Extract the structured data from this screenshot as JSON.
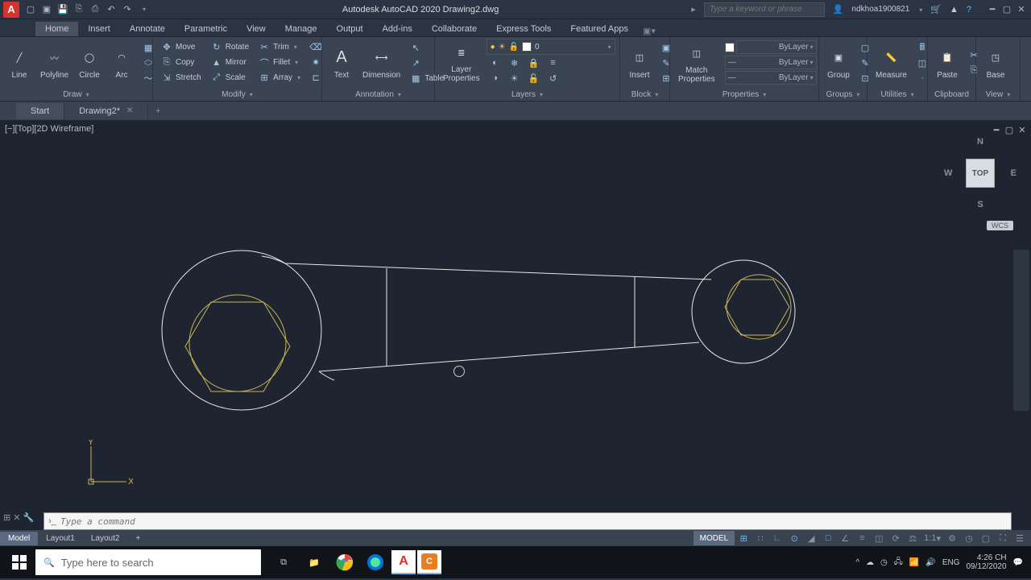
{
  "app": {
    "title": "Autodesk AutoCAD 2020   Drawing2.dwg",
    "search_placeholder": "Type a keyword or phrase",
    "username": "ndkhoa1900821"
  },
  "menu": {
    "tabs": [
      "Home",
      "Insert",
      "Annotate",
      "Parametric",
      "View",
      "Manage",
      "Output",
      "Add-ins",
      "Collaborate",
      "Express Tools",
      "Featured Apps"
    ],
    "active": 0
  },
  "ribbon": {
    "draw": {
      "title": "Draw",
      "line": "Line",
      "polyline": "Polyline",
      "circle": "Circle",
      "arc": "Arc"
    },
    "modify": {
      "title": "Modify",
      "move": "Move",
      "copy": "Copy",
      "stretch": "Stretch",
      "rotate": "Rotate",
      "mirror": "Mirror",
      "scale": "Scale",
      "trim": "Trim",
      "fillet": "Fillet",
      "array": "Array"
    },
    "annotation": {
      "title": "Annotation",
      "text": "Text",
      "dimension": "Dimension",
      "table": "Table"
    },
    "layers": {
      "title": "Layers",
      "properties": "Layer\nProperties",
      "current": "0"
    },
    "block": {
      "title": "Block",
      "insert": "Insert"
    },
    "properties": {
      "title": "Properties",
      "match": "Match\nProperties",
      "bylayer": "ByLayer"
    },
    "groups": {
      "title": "Groups",
      "group": "Group"
    },
    "utilities": {
      "title": "Utilities",
      "measure": "Measure"
    },
    "clipboard": {
      "title": "Clipboard",
      "paste": "Paste"
    },
    "view": {
      "title": "View",
      "base": "Base"
    }
  },
  "doc_tabs": {
    "start": "Start",
    "file": "Drawing2*"
  },
  "viewport": {
    "label": "[−][Top][2D Wireframe]",
    "cube": "TOP",
    "n": "N",
    "s": "S",
    "e": "E",
    "w": "W",
    "wcs": "WCS",
    "y": "Y",
    "x": "X"
  },
  "command": {
    "placeholder": "Type a command"
  },
  "layout": {
    "tabs": [
      "Model",
      "Layout1",
      "Layout2"
    ],
    "active": 0,
    "model_btn": "MODEL",
    "scale": "1:1",
    "lang": "ENG"
  },
  "taskbar": {
    "search_placeholder": "Type here to search",
    "time": "4:26 CH",
    "date": "09/12/2020"
  }
}
